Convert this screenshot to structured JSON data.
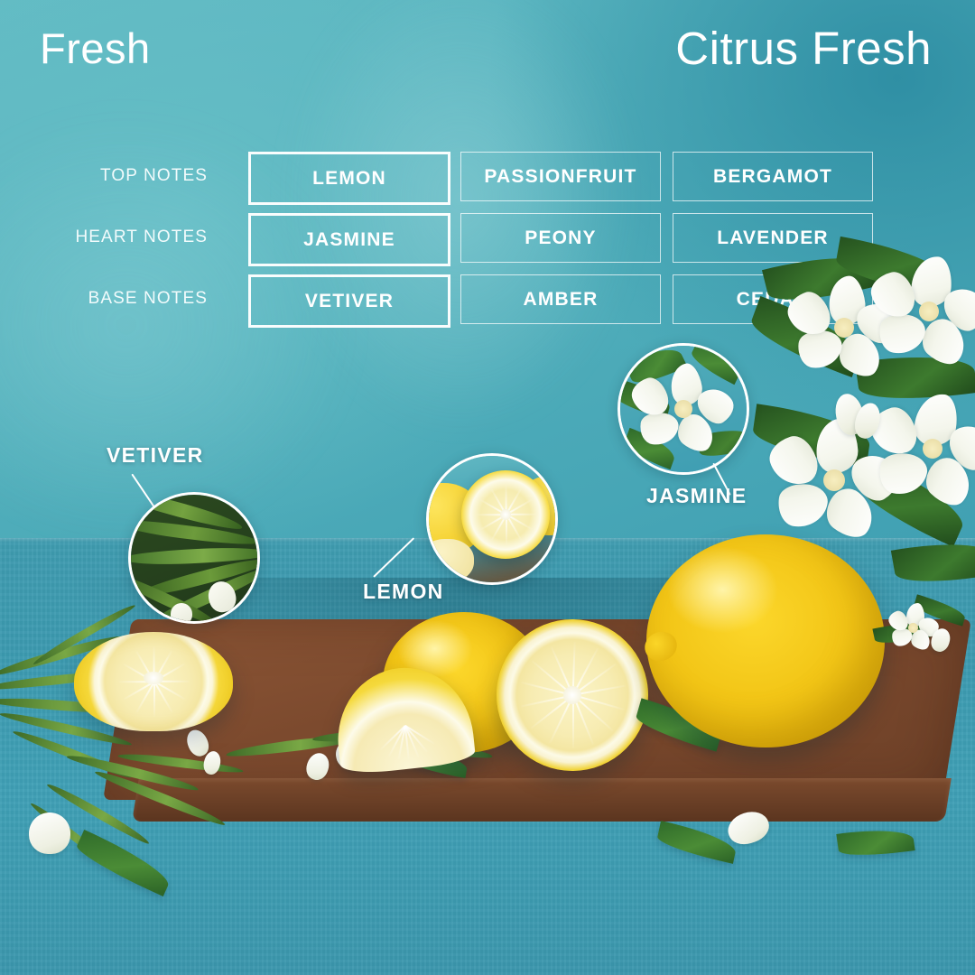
{
  "header": {
    "title_left": "Fresh",
    "title_right": "Citrus Fresh"
  },
  "notes_table": {
    "rows": [
      {
        "label": "TOP NOTES",
        "cells": [
          "LEMON",
          "PASSIONFRUIT",
          "BERGAMOT"
        ]
      },
      {
        "label": "HEART NOTES",
        "cells": [
          "JASMINE",
          "PEONY",
          "LAVENDER"
        ]
      },
      {
        "label": "BASE NOTES",
        "cells": [
          "VETIVER",
          "AMBER",
          "CEDAR"
        ]
      }
    ]
  },
  "callouts": [
    {
      "label": "VETIVER",
      "subject": "vetiver-sprig-closeup"
    },
    {
      "label": "LEMON",
      "subject": "lemon-half-closeup"
    },
    {
      "label": "JASMINE",
      "subject": "jasmine-flower-closeup"
    }
  ],
  "scene": {
    "description": "cutting-board-with-lemons-and-jasmine",
    "objects": [
      "wooden-cutting-board",
      "lemon-half-left",
      "lemon-whole-center",
      "lemon-wedge",
      "lemon-half-center",
      "lemon-whole-right",
      "vetiver-sprigs",
      "jasmine-flowers",
      "jasmine-buds",
      "green-leaves"
    ]
  },
  "colors": {
    "background_teal_light": "#66bec6",
    "background_teal_deep": "#2f8fa4",
    "table_surface": "#3f9cb0",
    "board_wood": "#7c4a2e",
    "lemon_yellow": "#f2c516",
    "accent_white": "#ffffff"
  }
}
